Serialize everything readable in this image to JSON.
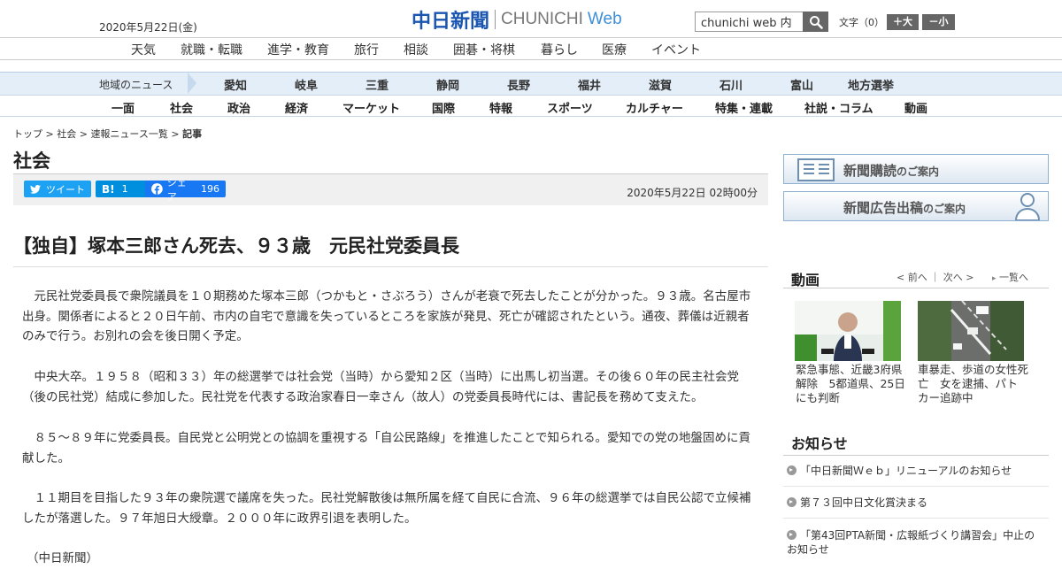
{
  "header": {
    "date": "2020年5月22日(金)",
    "logo_jp": "中日新聞",
    "logo_en": "CHUNICHI",
    "logo_web": "Web",
    "search_value": "chunichi web 内",
    "font_size_label": "文字（0）",
    "font_bigger": "＋大",
    "font_smaller": "－小",
    "brand_color": "#1a56b0"
  },
  "service_nav": [
    "天気",
    "就職・転職",
    "進学・教育",
    "旅行",
    "相談",
    "囲碁・将棋",
    "暮らし",
    "医療",
    "イベント"
  ],
  "region_nav": {
    "label": "地域のニュース",
    "items": [
      "愛知",
      "岐阜",
      "三重",
      "静岡",
      "長野",
      "福井",
      "滋賀",
      "石川",
      "富山",
      "地方選挙"
    ]
  },
  "category_nav": [
    "一面",
    "社会",
    "政治",
    "経済",
    "マーケット",
    "国際",
    "特報",
    "スポーツ",
    "カルチャー",
    "特集・連載",
    "社説・コラム",
    "動画"
  ],
  "breadcrumb": {
    "items": [
      "トップ",
      "社会",
      "速報ニュース一覧"
    ],
    "separator": ">",
    "current": "記事"
  },
  "section_title": "社会",
  "share": {
    "tweet": "ツイート",
    "hatena_label": "B!",
    "hatena_count": "1",
    "fb_label": "シェア",
    "fb_count": "196",
    "published": "2020年5月22日 02時00分"
  },
  "article": {
    "headline": "【独自】塚本三郎さん死去、９３歳　元民社党委員長",
    "paragraphs": [
      "元民社党委員長で衆院議員を１０期務めた塚本三郎（つかもと・さぶろう）さんが老衰で死去したことが分かった。９３歳。名古屋市出身。関係者によると２０日午前、市内の自宅で意識を失っているところを家族が発見、死亡が確認されたという。通夜、葬儀は近親者のみで行う。お別れの会を後日開く予定。",
      "中央大卒。１９５８（昭和３３）年の総選挙では社会党（当時）から愛知２区（当時）に出馬し初当選。その後６０年の民主社会党（後の民社党）結成に参加した。民社党を代表する政治家春日一幸さん（故人）の党委員長時代には、書記長を務めて支えた。",
      "８５～８９年に党委員長。自民党と公明党との協調を重視する「自公民路線」を推進したことで知られる。愛知での党の地盤固めに貢献した。",
      "１１期目を目指した９３年の衆院選で議席を失った。民社党解散後は無所属を経て自民に合流、９６年の総選挙では自民公認で立候補したが落選した。９７年旭日大綬章。２０００年に政界引退を表明した。",
      "（中日新聞）"
    ]
  },
  "sidebar": {
    "banner_subscribe": "新聞購読",
    "banner_subscribe_sub": "のご案内",
    "banner_ad": "新聞広告出稿",
    "banner_ad_sub": "のご案内",
    "video_title": "動画",
    "video_prev": "< 前へ",
    "video_next": "次へ >",
    "video_list": "一覧へ",
    "videos": [
      {
        "caption": "緊急事態、近畿3府県解除　5都道県、25日にも判断"
      },
      {
        "caption": "車暴走、歩道の女性死亡　女を逮捕、パトカー追跡中"
      }
    ],
    "notices_title": "お知らせ",
    "notices": [
      "「中日新聞Ｗｅｂ」リニューアルのお知らせ",
      "第７３回中日文化賞決まる",
      "「第43回PTA新聞・広報紙づくり講習会」中止のお知らせ"
    ]
  }
}
